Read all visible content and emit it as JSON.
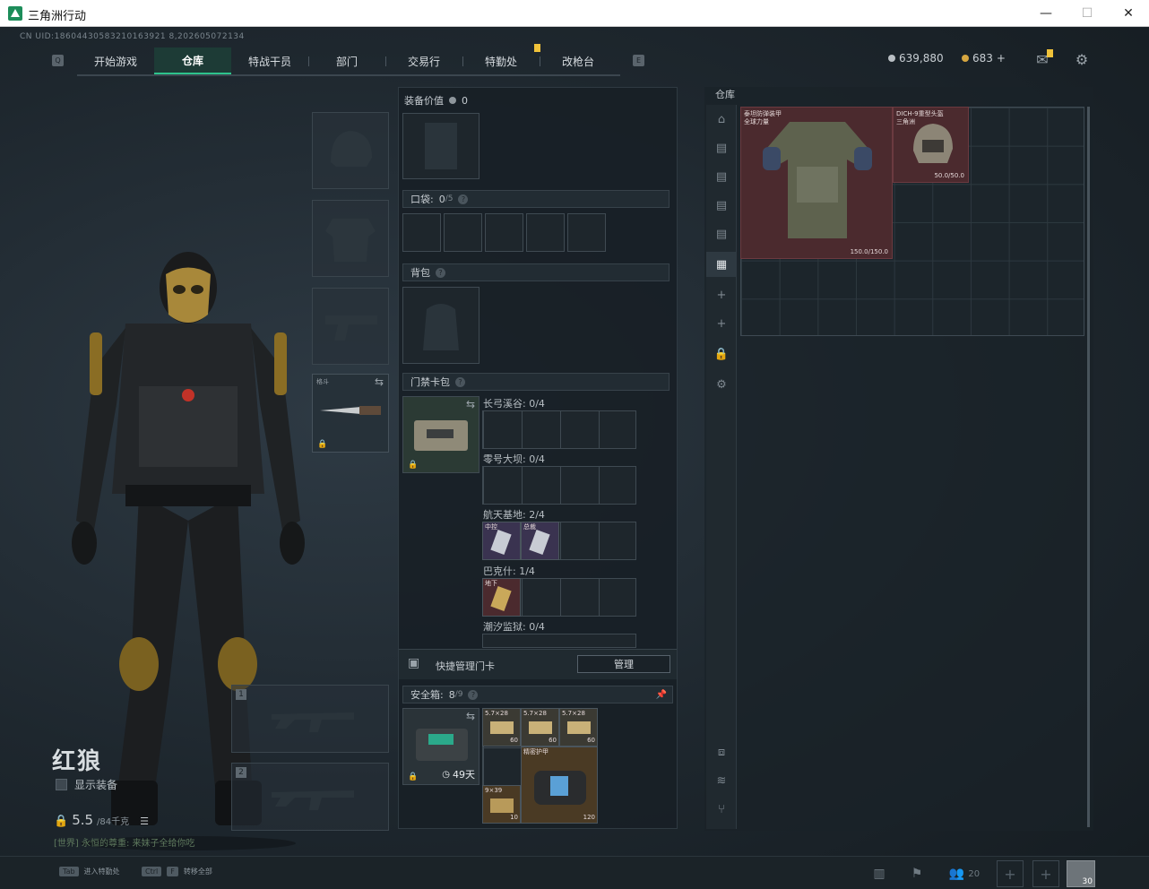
{
  "window": {
    "title": "三角洲行动",
    "minimize": "—",
    "maximize": "☐",
    "close": "✕"
  },
  "uid": "CN UID:18604430583210163921 8,202605072134",
  "nav": {
    "tabs": [
      "开始游戏",
      "仓库",
      "特战干员",
      "部门",
      "交易行",
      "特勤处",
      "改枪台"
    ],
    "active": "仓库",
    "left_key": "Q",
    "right_key": "E"
  },
  "currency": {
    "silver": "639,880",
    "gold": "683",
    "gold_plus": "+"
  },
  "character": {
    "name": "红狼",
    "show_equipment_label": "显示装备",
    "weight_value": "5.5",
    "weight_max": "/84千克",
    "world_message": "[世界] 永恒的尊重: 来妹子全给你吃"
  },
  "melee": {
    "label": "格斗"
  },
  "weapon_slots": [
    "1",
    "2"
  ],
  "equipment_value": {
    "label": "装备价值",
    "value": "0"
  },
  "pockets": {
    "label": "口袋:",
    "count": "0",
    "capacity": "/5"
  },
  "backpack": {
    "label": "背包"
  },
  "keycard_case": {
    "label": "门禁卡包",
    "maps": [
      {
        "name": "长弓溪谷: 0/4"
      },
      {
        "name": "零号大坝: 0/4"
      },
      {
        "name": "航天基地: 2/4"
      },
      {
        "name": "巴克什: 1/4"
      },
      {
        "name": "潮汐监狱: 0/4"
      }
    ],
    "card_labels": [
      "中控",
      "总裁",
      "地下"
    ]
  },
  "quick_manage": {
    "label": "快捷管理门卡",
    "button": "管理"
  },
  "safe_box": {
    "label": "安全箱:",
    "count": "8",
    "capacity": "/9",
    "days": "49天",
    "items": [
      {
        "name": "5.7×28",
        "qty": "60"
      },
      {
        "name": "5.7×28",
        "qty": "60"
      },
      {
        "name": "5.7×28",
        "qty": "60"
      },
      {
        "name": "9×39",
        "qty": "10"
      },
      {
        "name": "精密护甲",
        "qty": "120"
      }
    ]
  },
  "warehouse": {
    "label": "仓库",
    "vest_name": "泰坦防弹装甲",
    "vest_sub": "全球力量",
    "vest_durability": "150.0/150.0",
    "helmet_name": "DICH-9重型头盔",
    "helmet_sub": "三角洲",
    "helmet_durability": "50.0/50.0"
  },
  "bottom": {
    "tab_key": "Tab",
    "tab_hint": "进入特勤处",
    "ctrl_key": "Ctrl",
    "f_key": "F",
    "ctrl_hint": "转移全部",
    "friends_count": "20",
    "slot_count": "30"
  },
  "colors": {
    "accent_green": "#2ec38c",
    "item_red": "#4b2a2e",
    "badge_yellow": "#f0c23a"
  }
}
